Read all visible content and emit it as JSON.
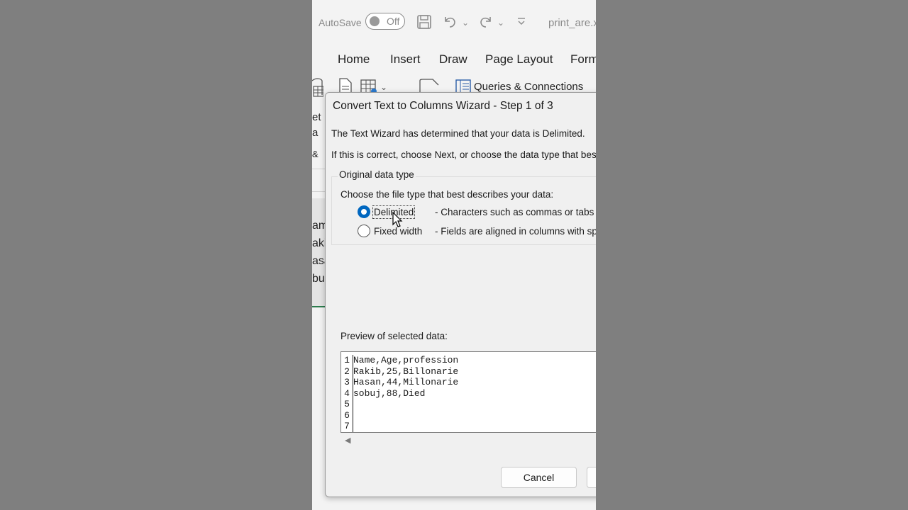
{
  "titlebar": {
    "autosave_label": "AutoSave",
    "autosave_state": "Off",
    "filename": "print_are.x",
    "icons": [
      "save-icon",
      "undo-icon",
      "redo-icon",
      "customize-qat-icon"
    ]
  },
  "ribbon_tabs": [
    "Home",
    "Insert",
    "Draw",
    "Page Layout",
    "Form"
  ],
  "ribbon": {
    "queries_label": "Queries & Connections",
    "left_fragments": [
      "et",
      "a",
      "&"
    ]
  },
  "sheet_fragments": [
    "am",
    "aki",
    "asa",
    "bu"
  ],
  "dialog": {
    "title": "Convert Text to Columns Wizard - Step 1 of 3",
    "line1": "The Text Wizard has determined that your data is Delimited.",
    "line2": "If this is correct, choose Next, or choose the data type that best",
    "group_title": "Original data type",
    "group_prompt": "Choose the file type that best describes your data:",
    "options": [
      {
        "label": "Delimited",
        "description": "- Characters such as commas or tabs s",
        "selected": true
      },
      {
        "label": "Fixed width",
        "description": "- Fields are aligned in columns with sp",
        "selected": false
      }
    ],
    "preview_label": "Preview of selected data:",
    "preview_rows": [
      {
        "num": "1",
        "text": "Name,Age,profession"
      },
      {
        "num": "2",
        "text": "Rakib,25,Billonarie"
      },
      {
        "num": "3",
        "text": "Hasan,44,Millonarie"
      },
      {
        "num": "4",
        "text": "sobuj,88,Died"
      },
      {
        "num": "5",
        "text": ""
      },
      {
        "num": "6",
        "text": ""
      },
      {
        "num": "7",
        "text": ""
      }
    ],
    "cancel_label": "Cancel"
  },
  "colors": {
    "radio_selected": "#0067c0",
    "background_dim": "#7f7f7f",
    "app_bg": "#f3f3f3",
    "dialog_bg": "#f0f0f0"
  }
}
